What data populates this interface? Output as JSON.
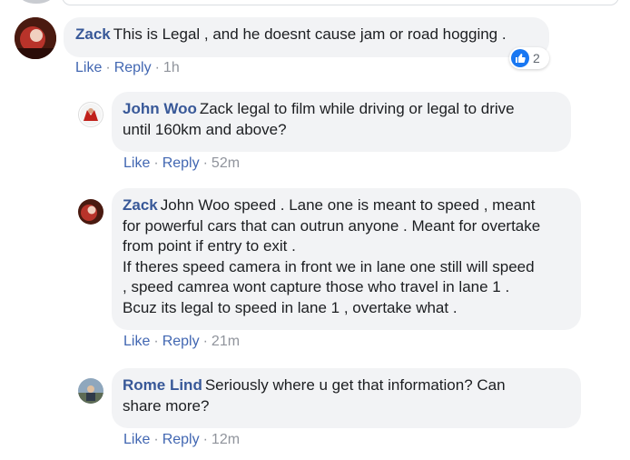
{
  "comments": [
    {
      "author": "Zack",
      "text": "This is Legal , and he doesnt cause jam or road hogging .",
      "actions": {
        "like": "Like",
        "reply": "Reply",
        "time": "1h"
      },
      "reaction_count": "2",
      "reaction_icon": "like-icon"
    },
    {
      "author": "John Woo",
      "text": "Zack legal to film while driving or legal to drive\nuntil 160km and above?",
      "actions": {
        "like": "Like",
        "reply": "Reply",
        "time": "52m"
      }
    },
    {
      "author": "Zack",
      "text": "John Woo speed . Lane one is meant to speed , meant\nfor powerful cars that can outrun anyone . Meant for overtake\nfrom point if entry to exit .\nIf theres speed camera in front we in lane one still will speed\n, speed camrea wont capture those who travel in lane 1 .\nBcuz its legal to speed in lane 1 , overtake what .",
      "actions": {
        "like": "Like",
        "reply": "Reply",
        "time": "21m"
      }
    },
    {
      "author": "Rome Lind",
      "text": "Seriously where u get that information? Can\nshare more?",
      "actions": {
        "like": "Like",
        "reply": "Reply",
        "time": "12m"
      }
    }
  ],
  "colors": {
    "author": "#385898",
    "link": "#4267b2",
    "bubble": "#f2f3f5",
    "meta": "#90949c",
    "like": "#1877f2"
  }
}
